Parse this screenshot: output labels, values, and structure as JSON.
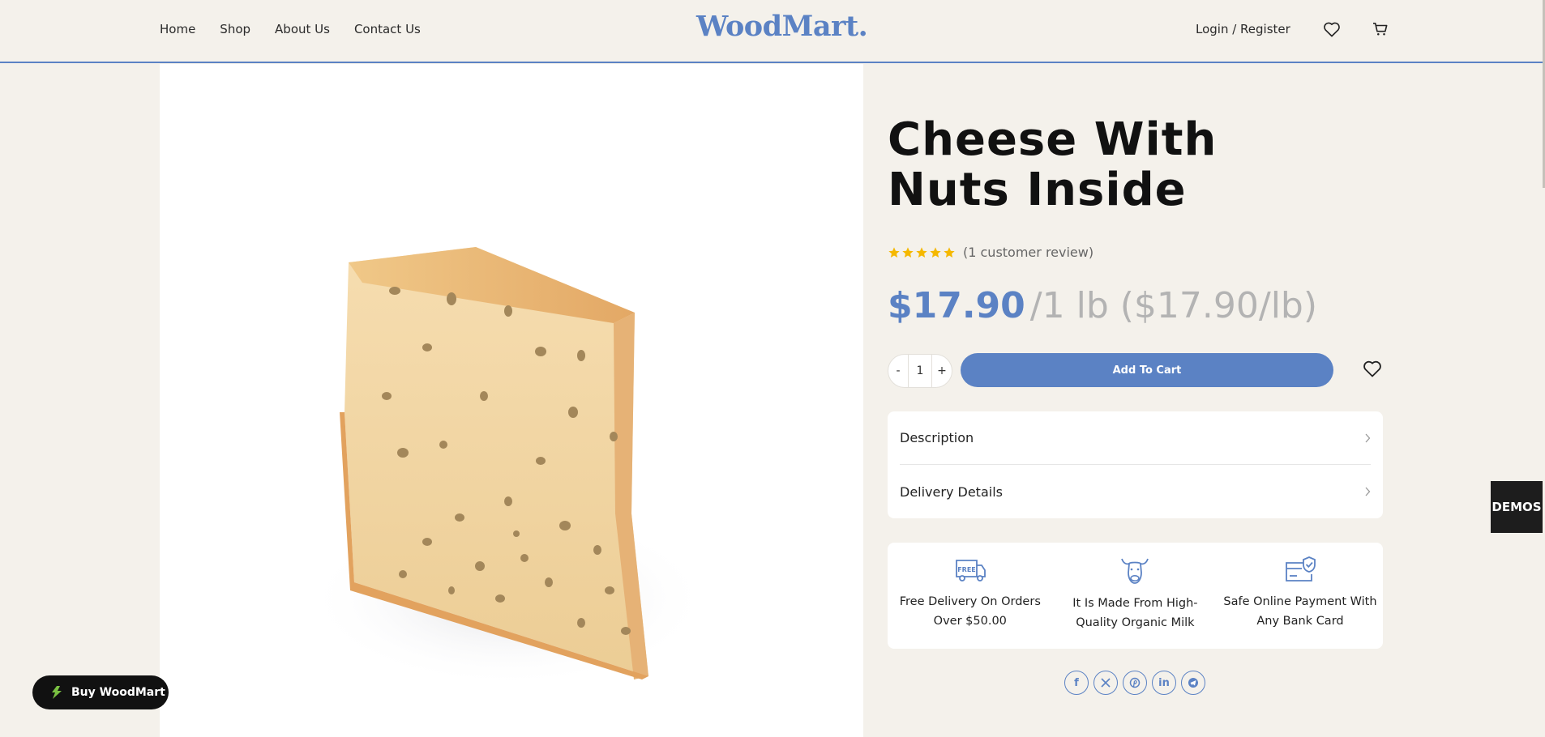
{
  "header": {
    "nav": [
      "Home",
      "Shop",
      "About Us",
      "Contact Us"
    ],
    "logo": "WoodMart.",
    "login": "Login / Register"
  },
  "product": {
    "title": "Cheese With Nuts Inside",
    "rating": 5,
    "review_count": "(1 customer review)",
    "price": "$17.90",
    "price_unit": "/1 lb ($17.90/lb)",
    "quantity": "1",
    "qty_minus": "-",
    "qty_plus": "+",
    "add_to_cart": "Add To Cart"
  },
  "accordion": [
    "Description",
    "Delivery Details"
  ],
  "features": [
    {
      "icon": "free-delivery-truck-icon",
      "text": "Free Delivery On Orders Over $50.00"
    },
    {
      "icon": "cow-icon",
      "text": "It Is Made From High-Quality Organic Milk"
    },
    {
      "icon": "secure-payment-icon",
      "text": "Safe Online Payment With Any Bank Card"
    }
  ],
  "social": [
    "facebook-icon",
    "x-icon",
    "pinterest-icon",
    "linkedin-icon",
    "telegram-icon"
  ],
  "demos_label": "DEMOS",
  "buy_button": "Buy WoodMart",
  "colors": {
    "accent": "#5b82c4",
    "background": "#f4f1eb",
    "dark": "#111111",
    "star": "#f5b800"
  }
}
